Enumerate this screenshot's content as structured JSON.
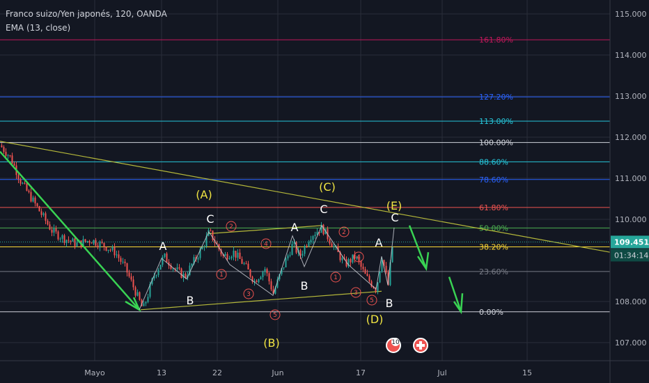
{
  "header": {
    "symbol_line": "Franco suizo/Yen japonés, 120, OANDA",
    "indicator_line": "EMA (13, close)"
  },
  "chart_data": {
    "type": "line",
    "y_axis": {
      "ticks": [
        "115.000",
        "114.000",
        "113.000",
        "112.000",
        "111.000",
        "110.000",
        "108.000",
        "107.000"
      ],
      "tick_values": [
        115,
        114,
        113,
        112,
        111,
        110,
        108,
        107
      ],
      "range": [
        106.6,
        115.3
      ]
    },
    "x_axis": {
      "ticks": [
        "Mayo",
        "13",
        "22",
        "Jun",
        "17",
        "Jul",
        "15"
      ]
    },
    "price_label": {
      "value": "109.451",
      "color": "#26a69a"
    },
    "countdown_label": {
      "value": "01:34:14",
      "color": "#26a69a"
    },
    "fib_levels": [
      {
        "label": "161.80%",
        "price": 114.37,
        "color": "#c2185b"
      },
      {
        "label": "127.20%",
        "price": 112.98,
        "color": "#2962ff"
      },
      {
        "label": "113.00%",
        "price": 112.39,
        "color": "#26c6da"
      },
      {
        "label": "100.00%",
        "price": 111.87,
        "color": "#d1d4dc"
      },
      {
        "label": "88.60%",
        "price": 111.4,
        "color": "#26c6da"
      },
      {
        "label": "78.60%",
        "price": 110.97,
        "color": "#2962ff"
      },
      {
        "label": "61.80%",
        "price": 110.29,
        "color": "#ef5350"
      },
      {
        "label": "50.00%",
        "price": 109.79,
        "color": "#4caf50"
      },
      {
        "label": "38.20%",
        "price": 109.33,
        "color": "#fdd835"
      },
      {
        "label": "23.60%",
        "price": 108.73,
        "color": "#787b86"
      },
      {
        "label": "0.00%",
        "price": 107.75,
        "color": "#d1d4dc"
      }
    ],
    "wave_labels_yellow": [
      "(A)",
      "(B)",
      "(C)",
      "(D)",
      "(E)"
    ],
    "wave_labels_white": [
      "A",
      "B",
      "C",
      "A",
      "B",
      "C",
      "A",
      "B",
      "C"
    ],
    "circled_counts": [
      "1",
      "2",
      "3",
      "4",
      "5",
      "1",
      "2",
      "3",
      "4",
      "5"
    ],
    "event_badge": "10",
    "colors": {
      "background": "#131722",
      "up": "#26a69a",
      "down": "#ef5350",
      "impulse": "#39d353",
      "trendline": "#b5b83a",
      "grid": "#2a2e39",
      "wave_yellow": "#f0e442"
    }
  }
}
